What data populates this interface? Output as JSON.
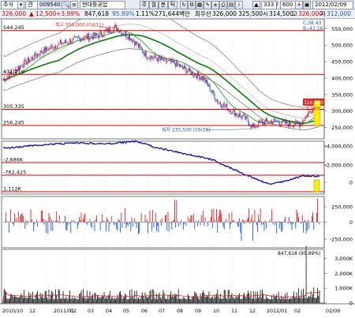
{
  "toolbar": {
    "market": "주식",
    "mode": "견",
    "code": "009540",
    "company": "현대중공업",
    "period_tabs": [
      "주",
      "월",
      "분",
      "틱"
    ],
    "count": "333",
    "count_max": "600",
    "date": "2012/02/09",
    "price_line": {
      "price": "326,000",
      "change": "▲ 12,500",
      "change_pct": "+3.99%",
      "volume": "847,618",
      "vol_ratio": "95.89%",
      "turnover": "1.11%",
      "amount": "271,644백만",
      "prev_label": "최우선",
      "prev": "326,000",
      "ask": "325,500",
      "open_label": "시",
      "open": "314,500",
      "high_label": "고",
      "high": "326,000",
      "low_label": "저",
      "low": "312,000"
    }
  },
  "colors": {
    "up": "#e02020",
    "down": "#1f5bd6",
    "ma_green": "#0a7a0a",
    "guide_red": "#d40000",
    "obv_blue": "#1010a8",
    "yellow": "#ffee00"
  },
  "price_panel": {
    "guide_labels": [
      "544,245",
      "411,216",
      "305,335",
      "256,245"
    ],
    "axis_ticks": [
      "550,000",
      "500,000",
      "450,000",
      "400,000",
      "350,000",
      "300,000",
      "250,000"
    ],
    "current_price_tag": "326,000",
    "current_pct_tag": "3.99%",
    "high_annotation": "최고 554,000 (04/11)",
    "low_annotation": "최저 235,500 (09/26)",
    "corner_label_1": "C:38.43",
    "corner_label_2": "B:-41.16"
  },
  "obv_panel": {
    "guide_labels": [
      "-2,686K",
      "-762,425",
      "1,112K"
    ],
    "axis_ticks": [
      "-4,000,000",
      "-2,000,000",
      "0"
    ]
  },
  "flow_panel": {
    "axis_ticks": [
      "250,000",
      "0",
      "-250,000"
    ]
  },
  "volume_panel": {
    "label": "847,618 (95.89%)",
    "axis_ticks": [
      "3,000K",
      "2,000K",
      "1,000K",
      "0"
    ]
  },
  "x_axis": {
    "labels": [
      "2010/10",
      "12",
      "2011/01",
      "02",
      "03",
      "04",
      "05",
      "06",
      "07",
      "08",
      "09",
      "10",
      "11",
      "12",
      "2012/01",
      "02",
      "02/09"
    ]
  }
}
